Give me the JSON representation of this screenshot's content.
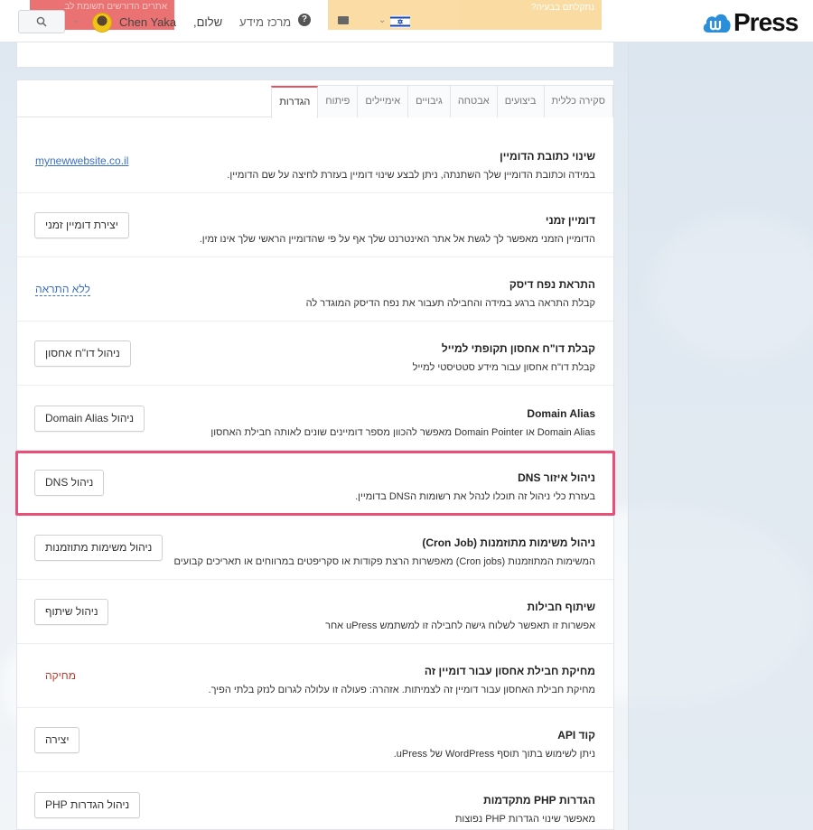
{
  "header": {
    "notification_red": "אתרים הדורשים תשומת לב",
    "notification_orange": "נתקלתם בבעיה?",
    "username": "Chen Yaka",
    "greeting": "שלום,",
    "help_center": "מרכז מידע",
    "logo_text": "Press",
    "flag": "israel-flag-icon"
  },
  "tabs": [
    {
      "label": "סקירה כללית",
      "active": false
    },
    {
      "label": "ביצועים",
      "active": false
    },
    {
      "label": "אבטחה",
      "active": false
    },
    {
      "label": "גיבויים",
      "active": false
    },
    {
      "label": "אימיילים",
      "active": false
    },
    {
      "label": "פיתוח",
      "active": false
    },
    {
      "label": "הגדרות",
      "active": true
    }
  ],
  "settings": [
    {
      "title": "שינוי כתובת הדומיין",
      "desc": "במידה וכתובת הדומיין שלך השתנתה, ניתן לבצע שינוי דומיין בעזרת לחיצה על שם הדומיין.",
      "action": "mynewwebsite.co.il",
      "action_type": "link"
    },
    {
      "title": "דומיין זמני",
      "desc": "הדומיין הזמני מאפשר לך לגשת אל אתר האינטרנט שלך אף על פי שהדומיין הראשי שלך אינו זמין.",
      "action": "יצירת דומיין זמני",
      "action_type": "button"
    },
    {
      "title": "התראת נפח דיסק",
      "desc": "קבלת התראה ברגע במידה והחבילה תעבור את נפח הדיסק המוגדר לה",
      "action": "ללא התראה",
      "action_type": "dotted"
    },
    {
      "title": "קבלת דו\"ח אחסון תקופתי למייל",
      "desc": "קבלת דו\"ח אחסון עבור מידע סטטיסטי למייל",
      "action": "ניהול דו\"ח אחסון",
      "action_type": "button"
    },
    {
      "title": "Domain Alias",
      "desc": "Domain Alias או Domain Pointer מאפשר להכוון מספר דומיינים שונים לאותה חבילת האחסון",
      "action": "ניהול Domain Alias",
      "action_type": "button"
    },
    {
      "title": "ניהול איזור DNS",
      "desc": "בעזרת כלי ניהול זה תוכלו לנהל את רשומות הDNS בדומיין.",
      "action": "ניהול DNS",
      "action_type": "button"
    },
    {
      "title": "ניהול משימות מתוזמנות (Cron Job)",
      "desc": "המשימות המתוזמנות (Cron jobs) מאפשרות הרצת פקודות או סקריפטים במרווחים או תאריכים קבועים",
      "action": "ניהול משימות מתוזמנות",
      "action_type": "button"
    },
    {
      "title": "שיתוף חבילות",
      "desc": "אפשרות זו תאפשר לשלוח גישה לחבילה זו למשתמש uPress אחר",
      "action": "ניהול שיתוף",
      "action_type": "button"
    },
    {
      "title": "מחיקת חבילת אחסון עבור דומיין זה",
      "desc": "מחיקת חבילת האחסון עבור דומיין זה לצמיתות. אזהרה: פעולה זו עלולה לגרום לנזק בלתי הפיך.",
      "action": "מחיקה",
      "action_type": "danger"
    },
    {
      "title": "קוד API",
      "desc": "ניתן לשימוש בתוך תוסף WordPress של uPress.",
      "action": "יצירה",
      "action_type": "button"
    },
    {
      "title": "הגדרות PHP מתקדמות",
      "desc": "מאפשר שינוי הגדרות PHP נפוצות",
      "action": "ניהול הגדרות PHP",
      "action_type": "button"
    }
  ],
  "colors": {
    "accent": "#e8505b",
    "highlight": "#e8507a",
    "link": "#3b6fc2",
    "danger": "#c0392b"
  }
}
